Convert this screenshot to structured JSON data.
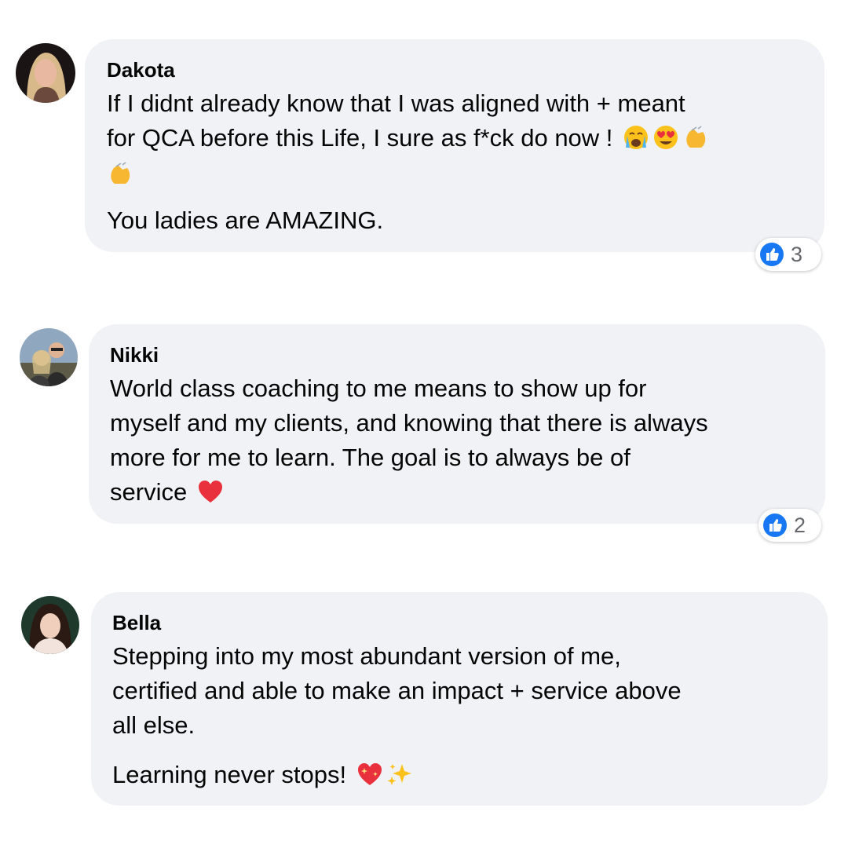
{
  "comments": [
    {
      "author": "Dakota",
      "lines": [
        "If I didnt already know that I was aligned with + meant",
        "for QCA before this Life, I sure as f*ck do now !"
      ],
      "emoji_line1": [
        "crying-face-icon",
        "heart-eyes-icon",
        "clapping-hands-icon"
      ],
      "emoji_line2": [
        "clapping-hands-icon"
      ],
      "paragraph2": "You ladies are AMAZING.",
      "reaction": {
        "icon": "like-icon",
        "count": "3"
      }
    },
    {
      "author": "Nikki",
      "lines": [
        "World class coaching to me means to show up for",
        "myself and my clients, and knowing that there is always",
        "more for me to learn. The goal is to always be of",
        "service"
      ],
      "emoji_end": [
        "red-heart-icon"
      ],
      "reaction": {
        "icon": "like-icon",
        "count": "2"
      }
    },
    {
      "author": "Bella",
      "lines": [
        "Stepping into my most abundant version of me,",
        "certified and able to make an impact + service above",
        "all else."
      ],
      "paragraph2": "Learning never stops!",
      "emoji_end": [
        "sparkling-heart-icon",
        "sparkles-icon"
      ]
    }
  ],
  "colors": {
    "bubble": "#f0f2f5",
    "like_blue": "#1877f2",
    "count_gray": "#65676b"
  }
}
